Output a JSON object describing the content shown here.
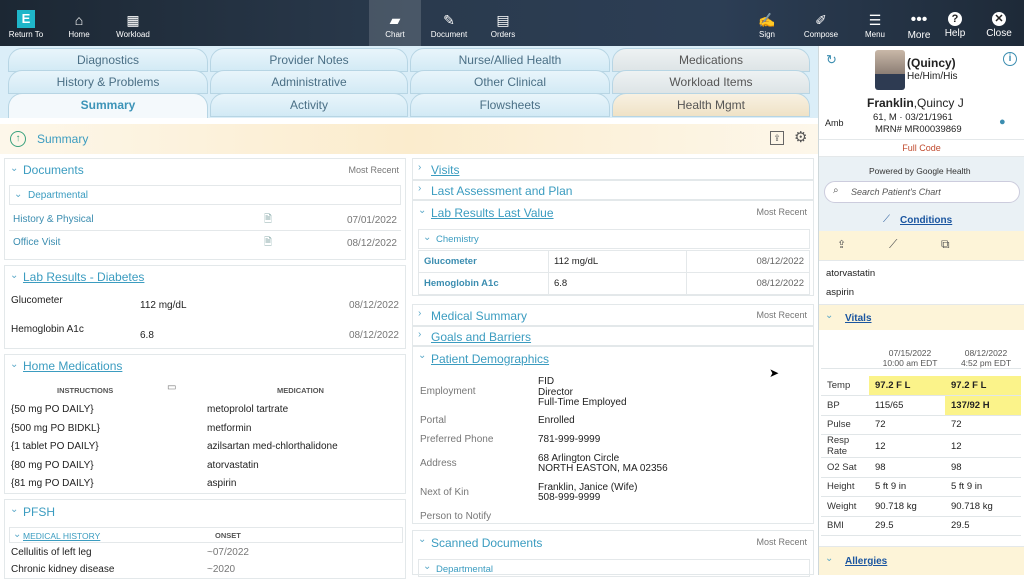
{
  "toolbar": {
    "return": "Return To",
    "home": "Home",
    "workload": "Workload",
    "chart": "Chart",
    "document": "Document",
    "orders": "Orders",
    "sign": "Sign",
    "compose": "Compose",
    "menu": "Menu",
    "more": "More",
    "help": "Help",
    "close": "Close",
    "logo_letter": "E"
  },
  "tabs": {
    "r1": [
      "Diagnostics",
      "Provider Notes",
      "Nurse/Allied Health",
      "Medications"
    ],
    "r2": [
      "History & Problems",
      "Administrative",
      "Other Clinical",
      "Workload Items"
    ],
    "r3": [
      "Summary",
      "Activity",
      "Flowsheets",
      "Health Mgmt"
    ]
  },
  "summary": {
    "title": "Summary"
  },
  "documents": {
    "title": "Documents",
    "tag": "Most Recent",
    "group": "Departmental",
    "rows": [
      {
        "name": "History & Physical",
        "date": "07/01/2022"
      },
      {
        "name": "Office Visit",
        "date": "08/12/2022"
      }
    ]
  },
  "lab_diab": {
    "title": "Lab Results - Diabetes",
    "rows": [
      {
        "name": "Glucometer",
        "value": "112 mg/dL",
        "date": "08/12/2022"
      },
      {
        "name": "Hemoglobin A1c",
        "value": "6.8",
        "date": "08/12/2022"
      }
    ]
  },
  "home_meds": {
    "title": "Home Medications",
    "col1": "INSTRUCTIONS",
    "col2": "MEDICATION",
    "rows": [
      {
        "i": "{50 mg PO DAILY}",
        "m": "metoprolol tartrate"
      },
      {
        "i": "{500 mg PO BIDKL}",
        "m": "metformin"
      },
      {
        "i": "{1 tablet PO DAILY}",
        "m": "azilsartan med-chlorthalidone"
      },
      {
        "i": "{80 mg PO DAILY}",
        "m": "atorvastatin"
      },
      {
        "i": "{81 mg PO DAILY}",
        "m": "aspirin"
      }
    ]
  },
  "pfsh": {
    "title": "PFSH",
    "col1": "MEDICAL HISTORY",
    "col2": "ONSET",
    "rows": [
      {
        "c": "Cellulitis of left leg",
        "o": "~07/2022"
      },
      {
        "c": "Chronic kidney disease",
        "o": "~2020"
      }
    ]
  },
  "mid": {
    "visits": "Visits",
    "last": "Last Assessment and Plan",
    "lab": "Lab Results Last Value",
    "lab_tag": "Most Recent",
    "chem": "Chemistry",
    "labrows": [
      {
        "n": "Glucometer",
        "v": "112 mg/dL",
        "d": "08/12/2022"
      },
      {
        "n": "Hemoglobin A1c",
        "v": "6.8",
        "d": "08/12/2022"
      }
    ],
    "medsum": "Medical Summary",
    "medsum_tag": "Most Recent",
    "goals": "Goals and Barriers",
    "demo": "Patient Demographics",
    "scanned": "Scanned Documents",
    "scanned_tag": "Most Recent",
    "dept": "Departmental"
  },
  "demo": {
    "employment_l": "Employment",
    "employment_v": [
      "FID",
      "Director",
      "Full-Time Employed"
    ],
    "portal_l": "Portal",
    "portal_v": "Enrolled",
    "phone_l": "Preferred Phone",
    "phone_v": "781-999-9999",
    "address_l": "Address",
    "address_v": [
      "68 Arlington Circle",
      "NORTH EASTON, MA 02356"
    ],
    "kin_l": "Next of Kin",
    "kin_v": [
      "Franklin, Janice (Wife)",
      "508-999-9999"
    ],
    "notify_l": "Person to Notify"
  },
  "patient": {
    "nickname": "(Quincy)",
    "pronouns": "He/Him/His",
    "last": "Franklin",
    "first": ",Quincy J",
    "age": "61, M · 03/21/1961",
    "mrn": "MRN# MR00039869",
    "amb": "Amb",
    "code": "Full Code",
    "powered": "Powered by Google Health",
    "search_ph": "Search Patient's Chart",
    "conditions": "Conditions",
    "meds": [
      "atorvastatin",
      "aspirin"
    ],
    "vitals": "Vitals",
    "allergies": "Allergies"
  },
  "vitals": {
    "cols": [
      [
        "07/15/2022",
        "10:00 am EDT"
      ],
      [
        "08/12/2022",
        "4:52 pm EDT"
      ]
    ],
    "rows": [
      {
        "n": "Temp",
        "a": "97.2 F L",
        "b": "97.2 F L",
        "ha": true,
        "hb": true
      },
      {
        "n": "BP",
        "a": "115/65",
        "b": "137/92 H",
        "ha": false,
        "hb": true
      },
      {
        "n": "Pulse",
        "a": "72",
        "b": "72"
      },
      {
        "n": "Resp Rate",
        "a": "12",
        "b": "12"
      },
      {
        "n": "O2 Sat",
        "a": "98",
        "b": "98"
      },
      {
        "n": "Height",
        "a": "5 ft 9 in",
        "b": "5 ft 9 in"
      },
      {
        "n": "Weight",
        "a": "90.718 kg",
        "b": "90.718 kg"
      },
      {
        "n": "BMI",
        "a": "29.5",
        "b": "29.5"
      }
    ]
  }
}
